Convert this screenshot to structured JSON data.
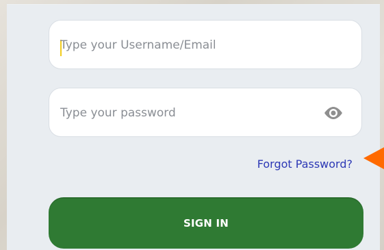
{
  "login": {
    "username_placeholder": "Type your Username/Email",
    "password_placeholder": "Type your password",
    "forgot_password_label": "Forgot Password?",
    "sign_in_label": "SIGN IN"
  },
  "icons": {
    "password_visibility": "eye-icon",
    "annotation_pointer": "arrow-left-icon"
  },
  "colors": {
    "panel_background": "#e9edf1",
    "input_background": "#ffffff",
    "link_color": "#2c38b5",
    "primary_button": "#2f7a33",
    "arrow_accent": "#ff6a00",
    "cursor_color": "#f2cc1c"
  }
}
